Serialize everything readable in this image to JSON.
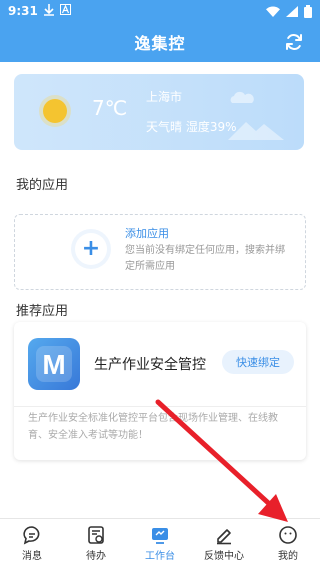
{
  "status_bar": {
    "time": "9:31",
    "icons_left": [
      "download-icon",
      "a-icon"
    ],
    "icons_right": [
      "wifi-icon",
      "signal-icon",
      "battery-icon"
    ]
  },
  "app_bar": {
    "title": "逸集控",
    "refresh_icon": "refresh-icon"
  },
  "weather": {
    "temperature": "7℃",
    "city": "上海市",
    "description": "天气晴 湿度39%"
  },
  "my_apps": {
    "title": "我的应用",
    "empty": {
      "add_label": "添加应用",
      "description": "您当前没有绑定任何应用，搜索并绑定所需应用"
    }
  },
  "recommended": {
    "title": "推荐应用",
    "app": {
      "name": "生产作业安全管控",
      "logo_letter": "M",
      "bind_label": "快速绑定",
      "description": "生产作业安全标准化管控平台包含现场作业管理、在线教育、安全准入考试等功能！"
    }
  },
  "bottom_nav": [
    {
      "label": "消息",
      "icon": "message-icon",
      "active": false
    },
    {
      "label": "待办",
      "icon": "todo-icon",
      "active": false
    },
    {
      "label": "工作台",
      "icon": "workbench-icon",
      "active": true
    },
    {
      "label": "反馈中心",
      "icon": "feedback-icon",
      "active": false
    },
    {
      "label": "我的",
      "icon": "profile-icon",
      "active": false
    }
  ],
  "colors": {
    "primary": "#4aa3f0",
    "accent": "#3a8ee6",
    "arrow": "#e8202a"
  }
}
